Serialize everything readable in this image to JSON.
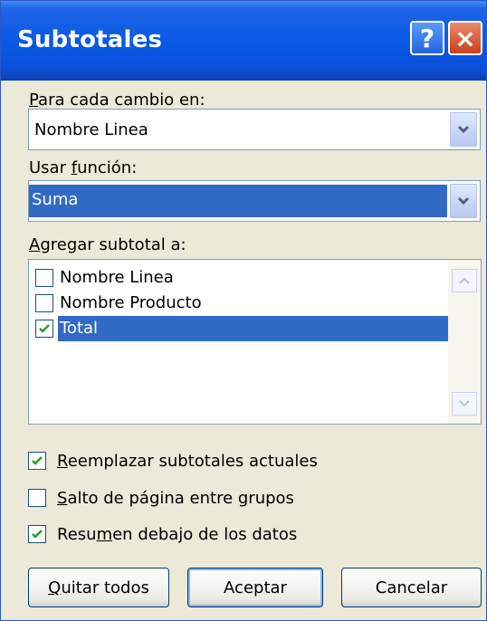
{
  "title": "Subtotales",
  "title_buttons": {
    "help": "?",
    "close": "×"
  },
  "label_each_change": {
    "pre": "",
    "key": "P",
    "post": "ara cada cambio en:"
  },
  "combo_each_change": {
    "value": "Nombre Linea"
  },
  "label_function": {
    "pre": "Usar ",
    "key": "f",
    "post": "unción:"
  },
  "combo_function": {
    "value": "Suma"
  },
  "label_add_subtotal": {
    "pre": "",
    "key": "A",
    "post": "gregar subtotal a:"
  },
  "fields": [
    {
      "label": "Nombre Linea",
      "checked": false,
      "selected": false
    },
    {
      "label": "Nombre Producto",
      "checked": false,
      "selected": false
    },
    {
      "label": "Total",
      "checked": true,
      "selected": true
    }
  ],
  "options": [
    {
      "pre": "",
      "key": "R",
      "post": "eemplazar subtotales actuales",
      "checked": true
    },
    {
      "pre": "",
      "key": "S",
      "post": "alto de página entre grupos",
      "checked": false
    },
    {
      "pre": "Resu",
      "key": "m",
      "post": "en debajo de los datos",
      "checked": true
    }
  ],
  "buttons": {
    "remove_all": {
      "pre": "",
      "key": "Q",
      "post": "uitar todos"
    },
    "accept": "Aceptar",
    "cancel": "Cancelar"
  },
  "colors": {
    "selection": "#316ac5",
    "check": "#21a121",
    "titlebar": "#0a5ae8",
    "dialog_bg": "#ece9d8"
  },
  "icons": {
    "dropdown": "chevron-down-icon",
    "check": "checkmark-icon"
  }
}
